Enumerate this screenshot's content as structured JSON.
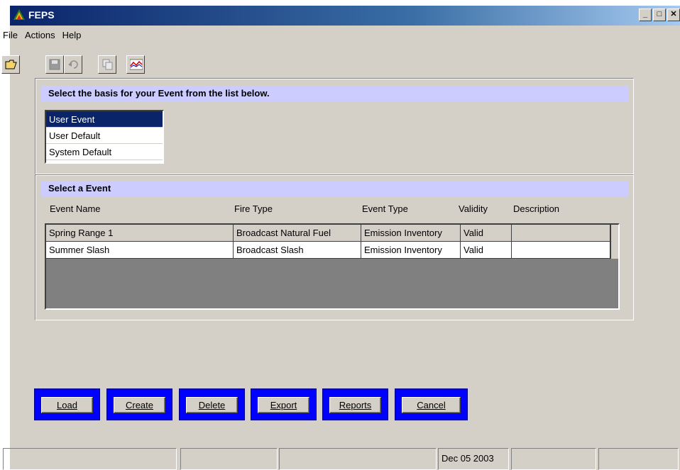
{
  "window": {
    "title": "FEPS"
  },
  "menu": [
    "File",
    "Actions",
    "Help"
  ],
  "toolbar": {
    "buttons": [
      {
        "name": "open-folder-icon",
        "enabled": true
      },
      {
        "name": "save-icon",
        "enabled": false
      },
      {
        "name": "undo-icon",
        "enabled": false
      },
      {
        "name": "copy-icon",
        "enabled": false
      },
      {
        "name": "chart-icon",
        "enabled": true
      }
    ]
  },
  "basis_panel": {
    "header": "Select the basis for your Event from the list below.",
    "items": [
      "User Event",
      "User Default",
      "System Default"
    ],
    "selected": "User Event"
  },
  "event_panel": {
    "header": "Select a Event",
    "columns": [
      "Event Name",
      "Fire Type",
      "Event Type",
      "Validity",
      "Description"
    ],
    "rows": [
      [
        "Spring Range 1",
        "Broadcast Natural Fuel",
        "Emission Inventory",
        "Valid",
        ""
      ],
      [
        "Summer Slash",
        "Broadcast Slash",
        "Emission Inventory",
        "Valid",
        ""
      ]
    ]
  },
  "buttons": {
    "load": "Load",
    "create": "Create",
    "delete": "Delete",
    "export": "Export",
    "reports": "Reports",
    "cancel": "Cancel"
  },
  "status": {
    "date": "Dec 05 2003"
  },
  "colors": {
    "titlebar": "#0a246a",
    "panel_header": "#ccccff",
    "button_frame": "#0000ff"
  }
}
